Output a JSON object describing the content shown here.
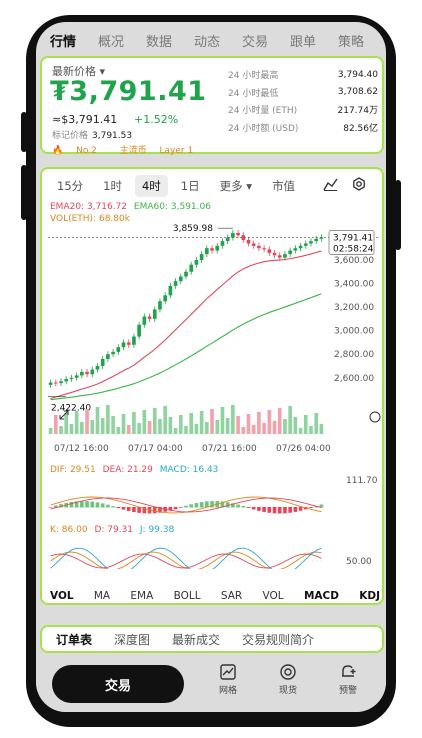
{
  "tabs": [
    "行情",
    "概况",
    "数据",
    "动态",
    "交易",
    "跟单",
    "策略"
  ],
  "ticker": {
    "label": "最新价格",
    "price": "₮3,791.41",
    "approx": "≈$3,791.41",
    "change": "+1.52%",
    "mark_label": "标记价格",
    "mark_value": "3,791.53",
    "tags": [
      "No.2",
      "主流币",
      "Layer 1"
    ],
    "stats": [
      {
        "k": "24 小时最高",
        "v": "3,794.40"
      },
      {
        "k": "24 小时最低",
        "v": "3,708.62"
      },
      {
        "k": "24 小时量 (ETH)",
        "v": "217.74万"
      },
      {
        "k": "24 小时额 (USD)",
        "v": "82.56亿"
      }
    ]
  },
  "toolbar": {
    "intervals": [
      "15分",
      "1时",
      "4时",
      "1日",
      "更多"
    ],
    "selected": "4时",
    "market_value": "市值"
  },
  "indicators": {
    "ema20_label": "EMA20: 3,716.72",
    "ema60_label": "EMA60: 3,591.06",
    "vol_label": "VOL(ETH): 68.80k",
    "macd_dif": "DIF: 29.51",
    "macd_dea": "DEA: 21.29",
    "macd_val": "MACD: 16.43",
    "kdj_k": "K: 86.00",
    "kdj_d": "D: 79.31",
    "kdj_j": "J: 99.38",
    "bottom": [
      "VOL",
      "MA",
      "EMA",
      "BOLL",
      "SAR",
      "VOL",
      "MACD",
      "KDJ"
    ],
    "bottom_active": [
      "VOL",
      "MACD",
      "KDJ"
    ]
  },
  "colors": {
    "up": "#1fa34b",
    "down": "#e8455a",
    "ema20": "#e2485c",
    "ema60": "#3db54a",
    "accent_frame": "#a6e24c"
  },
  "chart_data": {
    "type": "line",
    "price_axis": [
      "3,600.00",
      "3,400.00",
      "3,200.00",
      "3,000.00",
      "2,800.00",
      "2,600.00"
    ],
    "x_ticks": [
      "07/12 16:00",
      "07/17 04:00",
      "07/21 16:00",
      "07/26 04:00"
    ],
    "high_label": "3,859.98",
    "low_label": "2,422.40",
    "last_price": "3,791.41",
    "countdown": "02:58:24",
    "macd_axis": "111.70",
    "kdj_axis": "50.00",
    "close": [
      2560,
      2555,
      2570,
      2590,
      2600,
      2620,
      2650,
      2630,
      2670,
      2700,
      2760,
      2800,
      2820,
      2860,
      2900,
      2880,
      2950,
      3050,
      3120,
      3100,
      3180,
      3250,
      3300,
      3380,
      3420,
      3460,
      3500,
      3560,
      3600,
      3650,
      3700,
      3680,
      3720,
      3760,
      3790,
      3830,
      3810,
      3770,
      3740,
      3720,
      3700,
      3690,
      3660,
      3640,
      3620,
      3650,
      3680,
      3700,
      3720,
      3740,
      3760,
      3780,
      3791
    ]
  }
}
